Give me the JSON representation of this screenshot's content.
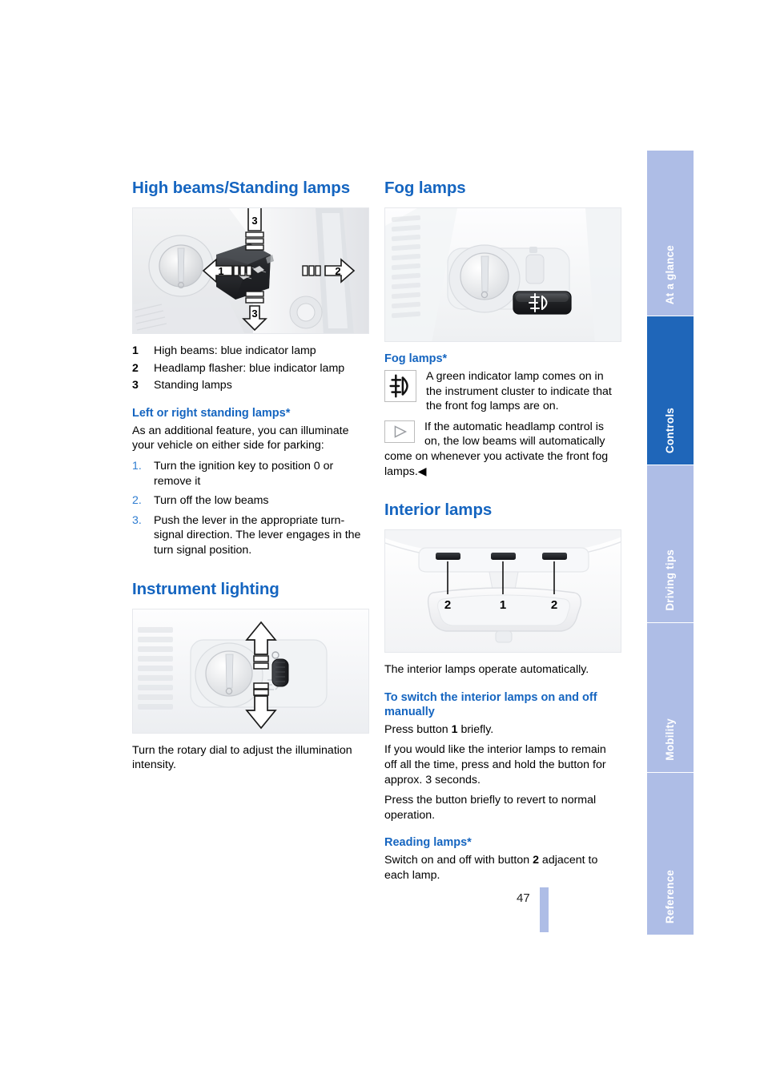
{
  "page": {
    "number": "47",
    "accent_blue": "#1565c0",
    "tab_active_color": "#1f66b9",
    "tab_inactive_color": "#aebde6"
  },
  "tabs": [
    {
      "label": "At a glance",
      "active": false
    },
    {
      "label": "Controls",
      "active": true
    },
    {
      "label": "Driving tips",
      "active": false
    },
    {
      "label": "Mobility",
      "active": false
    },
    {
      "label": "Reference",
      "active": false
    }
  ],
  "left_column": {
    "high_beams": {
      "heading": "High beams/Standing lamps",
      "figure": {
        "name": "steering-column-stalk-illustration",
        "callouts": [
          "3",
          "1",
          "2",
          "3"
        ]
      },
      "key_list": [
        {
          "num": "1",
          "text": "High beams: blue indicator lamp"
        },
        {
          "num": "2",
          "text": "Headlamp flasher: blue indicator lamp"
        },
        {
          "num": "3",
          "text": "Standing lamps"
        }
      ],
      "subheading": "Left or right standing lamps*",
      "intro": "As an additional feature, you can illuminate your vehicle on either side for parking:",
      "steps": [
        {
          "num": "1.",
          "text": "Turn the ignition key to position 0 or remove it"
        },
        {
          "num": "2.",
          "text": "Turn off the low beams"
        },
        {
          "num": "3.",
          "text": "Push the lever in the appropriate turn-signal direction. The lever engages in the turn signal position."
        }
      ]
    },
    "instrument_lighting": {
      "heading": "Instrument lighting",
      "figure": {
        "name": "instrument-lighting-rotary-dial-illustration"
      },
      "caption": "Turn the rotary dial to adjust the illumination intensity."
    }
  },
  "right_column": {
    "fog_lamps": {
      "heading": "Fog lamps",
      "figure": {
        "name": "fog-lamp-switch-illustration",
        "button_symbol": "fog-lamp-symbol"
      },
      "subheading": "Fog lamps*",
      "note_icon": "fog-lamp-indicator-icon",
      "note_text": "A green indicator lamp comes on in the instrument cluster to indicate that the front fog lamps are on.",
      "tip_icon": "triangle-play-icon",
      "tip_text_lead": "If the automatic headlamp control is on, the low beams will automatically",
      "tip_text_rest": "come on whenever you activate the front fog lamps.",
      "tip_end_marker": "◀"
    },
    "interior_lamps": {
      "heading": "Interior lamps",
      "figure": {
        "name": "overhead-console-interior-lamps-illustration",
        "callouts": [
          "2",
          "1",
          "2"
        ]
      },
      "intro": "The interior lamps operate automatically.",
      "manual_subheading": "To switch the interior lamps on and off manually",
      "manual_p1_a": "Press button ",
      "manual_p1_b": "1",
      "manual_p1_c": " briefly.",
      "manual_p2": "If you would like the interior lamps to remain off all the time, press and hold the button for approx. 3 seconds.",
      "manual_p3": "Press the button briefly to revert to normal operation.",
      "reading_subheading": "Reading lamps*",
      "reading_a": "Switch on and off with button ",
      "reading_b": "2",
      "reading_c": " adjacent to each lamp."
    }
  }
}
